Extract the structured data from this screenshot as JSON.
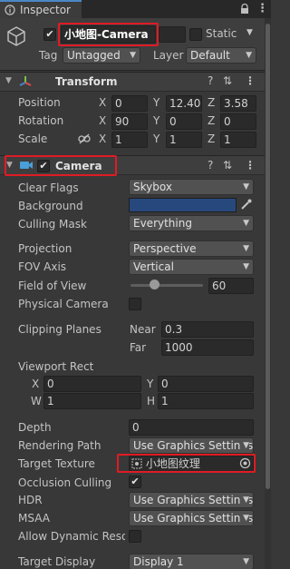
{
  "tab": {
    "title": "Inspector",
    "lock_icon": "lock-icon",
    "menu_icon": "kebab-menu-icon"
  },
  "object": {
    "name": "小地图-Camera",
    "static_label": "Static",
    "tag_label": "Tag",
    "tag_value": "Untagged",
    "layer_label": "Layer",
    "layer_value": "Default"
  },
  "transform": {
    "title": "Transform",
    "rows": [
      {
        "label": "Position",
        "x": "0",
        "y": "12.405",
        "z": "3.58"
      },
      {
        "label": "Rotation",
        "x": "90",
        "y": "0",
        "z": "0"
      },
      {
        "label": "Scale",
        "x": "1",
        "y": "1",
        "z": "1"
      }
    ]
  },
  "axes": {
    "x": "X",
    "y": "Y",
    "z": "Z",
    "w": "W",
    "h": "H"
  },
  "camera": {
    "title": "Camera",
    "clear_flags": {
      "label": "Clear Flags",
      "value": "Skybox"
    },
    "background": {
      "label": "Background",
      "color": "#27487c"
    },
    "culling_mask": {
      "label": "Culling Mask",
      "value": "Everything"
    },
    "projection": {
      "label": "Projection",
      "value": "Perspective"
    },
    "fov_axis": {
      "label": "FOV Axis",
      "value": "Vertical"
    },
    "field_of_view": {
      "label": "Field of View",
      "value": "60",
      "slider_fraction": 0.33
    },
    "physical_camera": {
      "label": "Physical Camera"
    },
    "clipping_planes": {
      "label": "Clipping Planes",
      "near_label": "Near",
      "near": "0.3",
      "far_label": "Far",
      "far": "1000"
    },
    "viewport_rect": {
      "label": "Viewport Rect",
      "x": "0",
      "y": "0",
      "w": "1",
      "h": "1"
    },
    "depth": {
      "label": "Depth",
      "value": "0"
    },
    "rendering_path": {
      "label": "Rendering Path",
      "value": "Use Graphics Settings"
    },
    "target_texture": {
      "label": "Target Texture",
      "value": "小地图纹理"
    },
    "occlusion_culling": {
      "label": "Occlusion Culling"
    },
    "hdr": {
      "label": "HDR",
      "value": "Use Graphics Settings"
    },
    "msaa": {
      "label": "MSAA",
      "value": "Use Graphics Settings"
    },
    "allow_dynamic": {
      "label": "Allow Dynamic Resol"
    },
    "target_display": {
      "label": "Target Display",
      "value": "Display 1"
    }
  },
  "colors": {
    "highlight": "#e01b24",
    "accent": "#4a87c7"
  }
}
